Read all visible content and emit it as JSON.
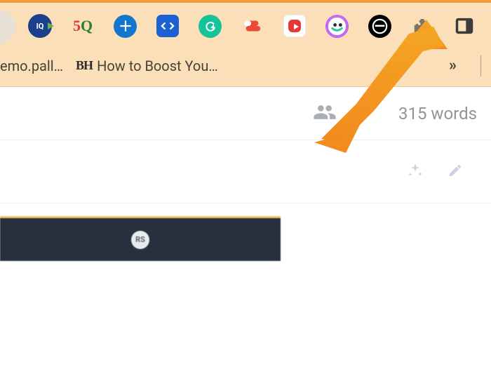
{
  "browser": {
    "extensions": [
      {
        "name": "iq",
        "label": "IQ"
      },
      {
        "name": "sq",
        "label": "SQ"
      },
      {
        "name": "plus",
        "label": "+"
      },
      {
        "name": "code",
        "label": "</>"
      },
      {
        "name": "grammarly",
        "label": "G"
      },
      {
        "name": "express",
        "label": ""
      },
      {
        "name": "yt",
        "label": ""
      },
      {
        "name": "loom",
        "label": ""
      },
      {
        "name": "smile",
        "label": "☻"
      },
      {
        "name": "extensions",
        "label": ""
      },
      {
        "name": "sidepanel",
        "label": ""
      }
    ],
    "bookmarks": {
      "item1": "emo.pall…",
      "item2": "How to Boost You…",
      "more": "»"
    }
  },
  "doc": {
    "word_count": "315 words"
  },
  "strip": {
    "badge": "RS"
  }
}
